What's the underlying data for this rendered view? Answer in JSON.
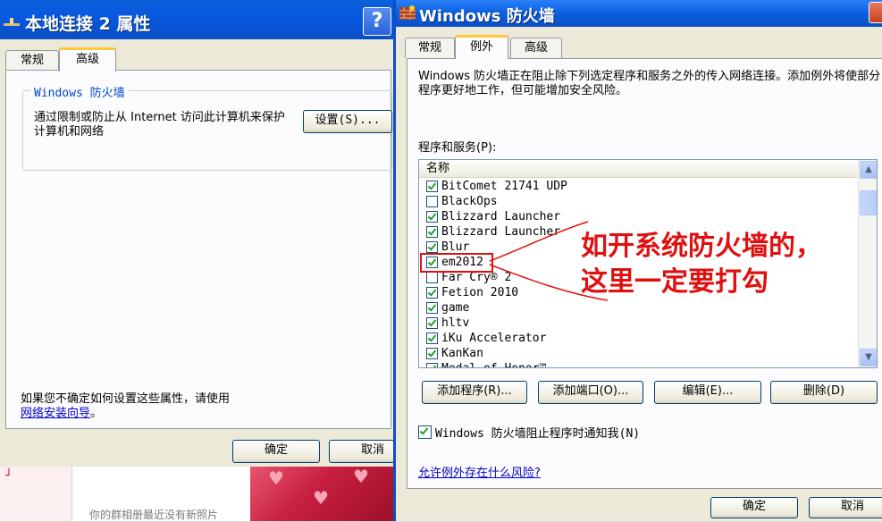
{
  "background": {
    "red_mark": "┘",
    "notice": "你的群相册最近没有新照片"
  },
  "left_window": {
    "title": "本地连接 2 属性",
    "help_label": "?",
    "tabs": [
      {
        "label": "常规"
      },
      {
        "label": "高级"
      }
    ],
    "group_title": "Windows 防火墙",
    "group_description": "通过限制或防止从 Internet 访问此计算机来保护计算机和网络",
    "settings_button": "设置(S)...",
    "hint_text": "如果您不确定如何设置这些属性，请使用",
    "hint_link": "网络安装向导",
    "hint_end": "。",
    "ok_button": "确定",
    "cancel_button": "取消"
  },
  "right_window": {
    "title": "Windows 防火墙",
    "tabs": [
      {
        "label": "常规"
      },
      {
        "label": "例外"
      },
      {
        "label": "高级"
      }
    ],
    "description": "Windows 防火墙正在阻止除下列选定程序和服务之外的传入网络连接。添加例外将使部分程序更好地工作，但可能增加安全风险。",
    "programs_label": "程序和服务(P):",
    "column_header": "名称",
    "programs": [
      {
        "name": "BitComet 21741 UDP",
        "checked": true
      },
      {
        "name": "BlackOps",
        "checked": false
      },
      {
        "name": "Blizzard Launcher",
        "checked": true
      },
      {
        "name": "Blizzard Launcher",
        "checked": true
      },
      {
        "name": "Blur",
        "checked": true
      },
      {
        "name": "em2012",
        "checked": true
      },
      {
        "name": "Far Cry® 2",
        "checked": false
      },
      {
        "name": "Fetion 2010",
        "checked": true
      },
      {
        "name": "game",
        "checked": true
      },
      {
        "name": "hltv",
        "checked": true
      },
      {
        "name": "iKu Accelerator",
        "checked": true
      },
      {
        "name": "KanKan",
        "checked": true
      },
      {
        "name": "Medal of Honor™",
        "checked": true
      }
    ],
    "buttons": {
      "add_program": "添加程序(R)...",
      "add_port": "添加端口(O)...",
      "edit": "编辑(E)...",
      "delete": "删除(D)"
    },
    "notify_checkbox": "Windows 防火墙阻止程序时通知我(N)",
    "notify_checked": true,
    "risk_link": "允许例外存在什么风险?",
    "ok_button": "确定",
    "cancel_button": "取消"
  },
  "annotation": {
    "line1": "如开系统防火墙的，",
    "line2": "这里一定要打勾",
    "color": "#e01010"
  }
}
